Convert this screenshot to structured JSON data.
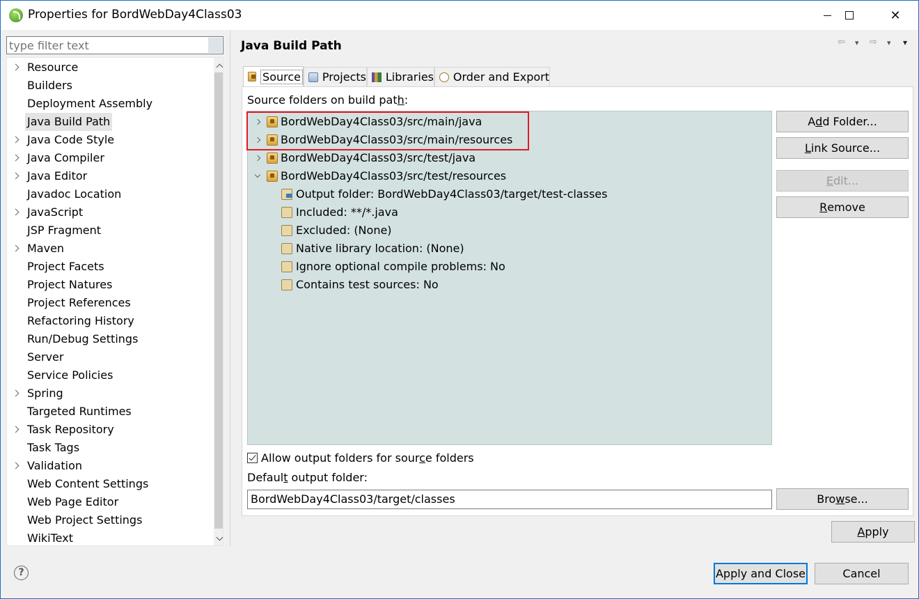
{
  "window": {
    "title": "Properties for BordWebDay4Class03",
    "minimize_icon": "minimize-icon",
    "maximize_icon": "maximize-icon",
    "close_icon": "close-icon",
    "close_glyph": "✕"
  },
  "filter": {
    "placeholder": "type filter text"
  },
  "sidebar": {
    "items": [
      {
        "label": "Resource",
        "expandable": true
      },
      {
        "label": "Builders",
        "expandable": false
      },
      {
        "label": "Deployment Assembly",
        "expandable": false
      },
      {
        "label": "Java Build Path",
        "expandable": false,
        "selected": true
      },
      {
        "label": "Java Code Style",
        "expandable": true
      },
      {
        "label": "Java Compiler",
        "expandable": true
      },
      {
        "label": "Java Editor",
        "expandable": true
      },
      {
        "label": "Javadoc Location",
        "expandable": false
      },
      {
        "label": "JavaScript",
        "expandable": true
      },
      {
        "label": "JSP Fragment",
        "expandable": false
      },
      {
        "label": "Maven",
        "expandable": true
      },
      {
        "label": "Project Facets",
        "expandable": false
      },
      {
        "label": "Project Natures",
        "expandable": false
      },
      {
        "label": "Project References",
        "expandable": false
      },
      {
        "label": "Refactoring History",
        "expandable": false
      },
      {
        "label": "Run/Debug Settings",
        "expandable": false
      },
      {
        "label": "Server",
        "expandable": false
      },
      {
        "label": "Service Policies",
        "expandable": false
      },
      {
        "label": "Spring",
        "expandable": true
      },
      {
        "label": "Targeted Runtimes",
        "expandable": false
      },
      {
        "label": "Task Repository",
        "expandable": true
      },
      {
        "label": "Task Tags",
        "expandable": false
      },
      {
        "label": "Validation",
        "expandable": true
      },
      {
        "label": "Web Content Settings",
        "expandable": false
      },
      {
        "label": "Web Page Editor",
        "expandable": false
      },
      {
        "label": "Web Project Settings",
        "expandable": false
      },
      {
        "label": "WikiText",
        "expandable": false
      }
    ]
  },
  "page": {
    "title": "Java Build Path",
    "tabs": [
      {
        "label": "Source",
        "icon": "source-folder-icon",
        "active": true
      },
      {
        "label": "Projects",
        "icon": "projects-icon",
        "active": false
      },
      {
        "label": "Libraries",
        "icon": "libraries-icon",
        "active": false
      },
      {
        "label": "Order and Export",
        "icon": "order-export-icon",
        "active": false
      }
    ],
    "section_label_a": "Source folders on build pat",
    "section_label_u": "h",
    "section_label_b": ":",
    "source_tree": [
      {
        "label": "BordWebDay4Class03/src/main/java",
        "level": 0,
        "expanded": false
      },
      {
        "label": "BordWebDay4Class03/src/main/resources",
        "level": 0,
        "expanded": false
      },
      {
        "label": "BordWebDay4Class03/src/test/java",
        "level": 0,
        "expanded": false
      },
      {
        "label": "BordWebDay4Class03/src/test/resources",
        "level": 0,
        "expanded": true
      },
      {
        "label": "Output folder: BordWebDay4Class03/target/test-classes",
        "level": 1
      },
      {
        "label": "Included: **/*.java",
        "level": 1
      },
      {
        "label": "Excluded: (None)",
        "level": 1
      },
      {
        "label": "Native library location: (None)",
        "level": 1
      },
      {
        "label": "Ignore optional compile problems: No",
        "level": 1
      },
      {
        "label": "Contains test sources: No",
        "level": 1
      }
    ],
    "buttons": {
      "add_folder_pre": "A",
      "add_folder_u": "d",
      "add_folder_post": "d Folder...",
      "link_source_u": "L",
      "link_source_post": "ink Source...",
      "edit_u": "E",
      "edit_post": "dit...",
      "remove_u": "R",
      "remove_post": "emove"
    },
    "allow_output_pre": "Allow output folders for sour",
    "allow_output_u": "c",
    "allow_output_post": "e folders",
    "allow_output_checked": true,
    "default_output_pre": "Defaul",
    "default_output_u": "t",
    "default_output_post": " output folder:",
    "default_output_value": "BordWebDay4Class03/target/classes",
    "browse_pre": "Bro",
    "browse_u": "w",
    "browse_post": "se..."
  },
  "footer": {
    "apply_u": "A",
    "apply_post": "pply",
    "apply_and_close": "Apply and Close",
    "cancel": "Cancel",
    "help_glyph": "?"
  },
  "nav_arrow_glyphs": [
    "⇦",
    "▾",
    "⇨",
    "▾",
    "▾"
  ]
}
